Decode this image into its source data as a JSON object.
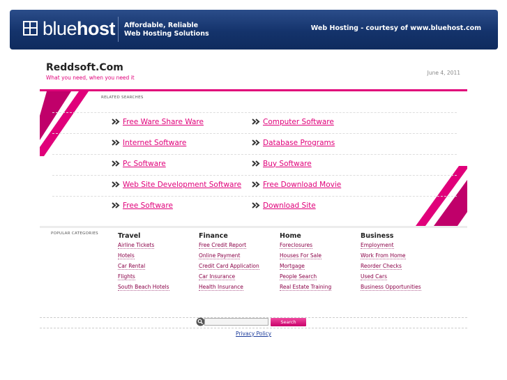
{
  "banner": {
    "logo_light": "blue",
    "logo_bold": "host",
    "tagline_line1": "Affordable, Reliable",
    "tagline_line2": "Web Hosting Solutions",
    "courtesy": "Web Hosting - courtesy of www.bluehost.com"
  },
  "site": {
    "title": "Reddsoft.Com",
    "subtitle": "What you need, when you need it",
    "date": "June 4, 2011"
  },
  "related": {
    "label": "RELATED SEARCHES",
    "rows": [
      [
        "Free Ware Share Ware",
        "Computer Software"
      ],
      [
        "Internet Software",
        "Database Programs"
      ],
      [
        "Pc Software",
        "Buy Software"
      ],
      [
        "Web Site Development Software",
        "Free Download Movie"
      ],
      [
        "Free Software",
        "Download Site"
      ]
    ]
  },
  "popular": {
    "label": "POPULAR CATEGORIES",
    "columns": [
      {
        "heading": "Travel",
        "items": [
          "Airline Tickets",
          "Hotels",
          "Car Rental",
          "Flights",
          "South Beach Hotels"
        ]
      },
      {
        "heading": "Finance",
        "items": [
          "Free Credit Report",
          "Online Payment",
          "Credit Card Application",
          "Car Insurance",
          "Health Insurance"
        ]
      },
      {
        "heading": "Home",
        "items": [
          "Foreclosures",
          "Houses For Sale",
          "Mortgage",
          "People Search",
          "Real Estate Training"
        ]
      },
      {
        "heading": "Business",
        "items": [
          "Employment",
          "Work From Home",
          "Reorder Checks",
          "Used Cars",
          "Business Opportunities"
        ]
      }
    ]
  },
  "search": {
    "value": "",
    "button_label": "Search"
  },
  "footer": {
    "privacy": "Privacy Policy"
  },
  "colors": {
    "accent": "#e0007a",
    "banner": "#14336b"
  }
}
